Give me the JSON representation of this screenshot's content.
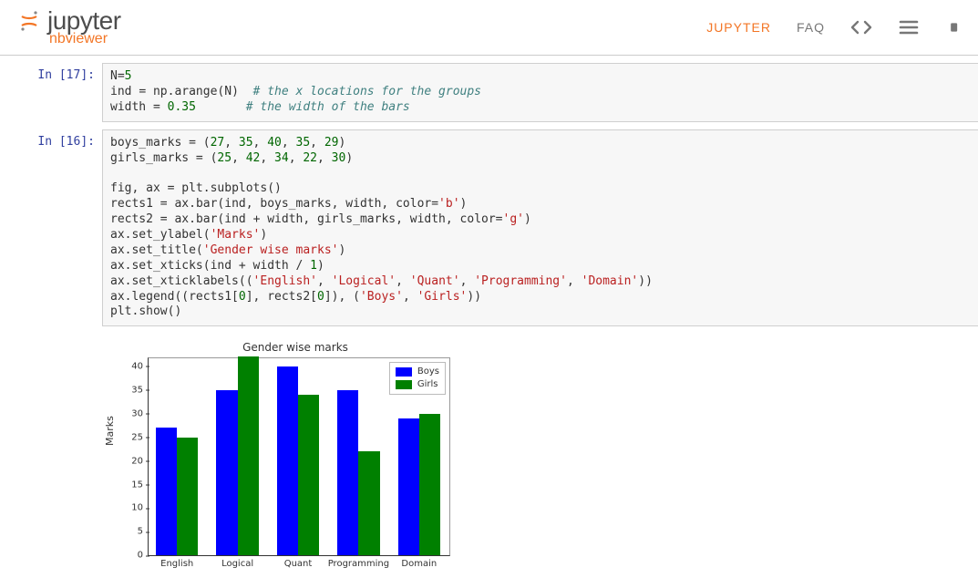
{
  "header": {
    "logo_text": "jupyter",
    "logo_sub": "nbviewer",
    "nav": {
      "jupyter": "JUPYTER",
      "faq": "FAQ"
    }
  },
  "cells": [
    {
      "prompt": "In [17]:",
      "lines": [
        [
          {
            "t": "N",
            "c": ""
          },
          {
            "t": "=",
            "c": "op"
          },
          {
            "t": "5",
            "c": "num"
          }
        ],
        [
          {
            "t": "ind ",
            "c": ""
          },
          {
            "t": "=",
            "c": "op"
          },
          {
            "t": " np",
            "c": ""
          },
          {
            "t": ".",
            "c": "op"
          },
          {
            "t": "arange(N)  ",
            "c": ""
          },
          {
            "t": "# the x locations for the groups",
            "c": "com"
          }
        ],
        [
          {
            "t": "width ",
            "c": ""
          },
          {
            "t": "=",
            "c": "op"
          },
          {
            "t": " ",
            "c": ""
          },
          {
            "t": "0.35",
            "c": "num"
          },
          {
            "t": "       ",
            "c": ""
          },
          {
            "t": "# the width of the bars",
            "c": "com"
          }
        ]
      ]
    },
    {
      "prompt": "In [16]:",
      "lines": [
        [
          {
            "t": "boys_marks ",
            "c": ""
          },
          {
            "t": "=",
            "c": "op"
          },
          {
            "t": " (",
            "c": ""
          },
          {
            "t": "27",
            "c": "num"
          },
          {
            "t": ", ",
            "c": ""
          },
          {
            "t": "35",
            "c": "num"
          },
          {
            "t": ", ",
            "c": ""
          },
          {
            "t": "40",
            "c": "num"
          },
          {
            "t": ", ",
            "c": ""
          },
          {
            "t": "35",
            "c": "num"
          },
          {
            "t": ", ",
            "c": ""
          },
          {
            "t": "29",
            "c": "num"
          },
          {
            "t": ")",
            "c": ""
          }
        ],
        [
          {
            "t": "girls_marks ",
            "c": ""
          },
          {
            "t": "=",
            "c": "op"
          },
          {
            "t": " (",
            "c": ""
          },
          {
            "t": "25",
            "c": "num"
          },
          {
            "t": ", ",
            "c": ""
          },
          {
            "t": "42",
            "c": "num"
          },
          {
            "t": ", ",
            "c": ""
          },
          {
            "t": "34",
            "c": "num"
          },
          {
            "t": ", ",
            "c": ""
          },
          {
            "t": "22",
            "c": "num"
          },
          {
            "t": ", ",
            "c": ""
          },
          {
            "t": "30",
            "c": "num"
          },
          {
            "t": ")",
            "c": ""
          }
        ],
        [
          {
            "t": "",
            "c": ""
          }
        ],
        [
          {
            "t": "fig, ax ",
            "c": ""
          },
          {
            "t": "=",
            "c": "op"
          },
          {
            "t": " plt",
            "c": ""
          },
          {
            "t": ".",
            "c": "op"
          },
          {
            "t": "subplots()",
            "c": ""
          }
        ],
        [
          {
            "t": "rects1 ",
            "c": ""
          },
          {
            "t": "=",
            "c": "op"
          },
          {
            "t": " ax",
            "c": ""
          },
          {
            "t": ".",
            "c": "op"
          },
          {
            "t": "bar(ind, boys_marks, width, color",
            "c": ""
          },
          {
            "t": "=",
            "c": "op"
          },
          {
            "t": "'b'",
            "c": "str"
          },
          {
            "t": ")",
            "c": ""
          }
        ],
        [
          {
            "t": "rects2 ",
            "c": ""
          },
          {
            "t": "=",
            "c": "op"
          },
          {
            "t": " ax",
            "c": ""
          },
          {
            "t": ".",
            "c": "op"
          },
          {
            "t": "bar(ind ",
            "c": ""
          },
          {
            "t": "+",
            "c": "op"
          },
          {
            "t": " width, girls_marks, width, color",
            "c": ""
          },
          {
            "t": "=",
            "c": "op"
          },
          {
            "t": "'g'",
            "c": "str"
          },
          {
            "t": ")",
            "c": ""
          }
        ],
        [
          {
            "t": "ax",
            "c": ""
          },
          {
            "t": ".",
            "c": "op"
          },
          {
            "t": "set_ylabel(",
            "c": ""
          },
          {
            "t": "'Marks'",
            "c": "str"
          },
          {
            "t": ")",
            "c": ""
          }
        ],
        [
          {
            "t": "ax",
            "c": ""
          },
          {
            "t": ".",
            "c": "op"
          },
          {
            "t": "set_title(",
            "c": ""
          },
          {
            "t": "'Gender wise marks'",
            "c": "str"
          },
          {
            "t": ")",
            "c": ""
          }
        ],
        [
          {
            "t": "ax",
            "c": ""
          },
          {
            "t": ".",
            "c": "op"
          },
          {
            "t": "set_xticks(ind ",
            "c": ""
          },
          {
            "t": "+",
            "c": "op"
          },
          {
            "t": " width ",
            "c": ""
          },
          {
            "t": "/",
            "c": "op"
          },
          {
            "t": " ",
            "c": ""
          },
          {
            "t": "1",
            "c": "num"
          },
          {
            "t": ")",
            "c": ""
          }
        ],
        [
          {
            "t": "ax",
            "c": ""
          },
          {
            "t": ".",
            "c": "op"
          },
          {
            "t": "set_xticklabels((",
            "c": ""
          },
          {
            "t": "'English'",
            "c": "str"
          },
          {
            "t": ", ",
            "c": ""
          },
          {
            "t": "'Logical'",
            "c": "str"
          },
          {
            "t": ", ",
            "c": ""
          },
          {
            "t": "'Quant'",
            "c": "str"
          },
          {
            "t": ", ",
            "c": ""
          },
          {
            "t": "'Programming'",
            "c": "str"
          },
          {
            "t": ", ",
            "c": ""
          },
          {
            "t": "'Domain'",
            "c": "str"
          },
          {
            "t": "))",
            "c": ""
          }
        ],
        [
          {
            "t": "ax",
            "c": ""
          },
          {
            "t": ".",
            "c": "op"
          },
          {
            "t": "legend((rects1[",
            "c": ""
          },
          {
            "t": "0",
            "c": "num"
          },
          {
            "t": "], rects2[",
            "c": ""
          },
          {
            "t": "0",
            "c": "num"
          },
          {
            "t": "]), (",
            "c": ""
          },
          {
            "t": "'Boys'",
            "c": "str"
          },
          {
            "t": ", ",
            "c": ""
          },
          {
            "t": "'Girls'",
            "c": "str"
          },
          {
            "t": "))",
            "c": ""
          }
        ],
        [
          {
            "t": "plt",
            "c": ""
          },
          {
            "t": ".",
            "c": "op"
          },
          {
            "t": "show()",
            "c": ""
          }
        ]
      ]
    }
  ],
  "chart_data": {
    "type": "bar",
    "title": "Gender wise marks",
    "ylabel": "Marks",
    "xlabel": "",
    "categories": [
      "English",
      "Logical",
      "Quant",
      "Programming",
      "Domain"
    ],
    "series": [
      {
        "name": "Boys",
        "color": "#0000ff",
        "values": [
          27,
          35,
          40,
          35,
          29
        ]
      },
      {
        "name": "Girls",
        "color": "#008000",
        "values": [
          25,
          42,
          34,
          22,
          30
        ]
      }
    ],
    "ylim": [
      0,
      42
    ],
    "yticks": [
      0,
      5,
      10,
      15,
      20,
      25,
      30,
      35,
      40
    ]
  }
}
